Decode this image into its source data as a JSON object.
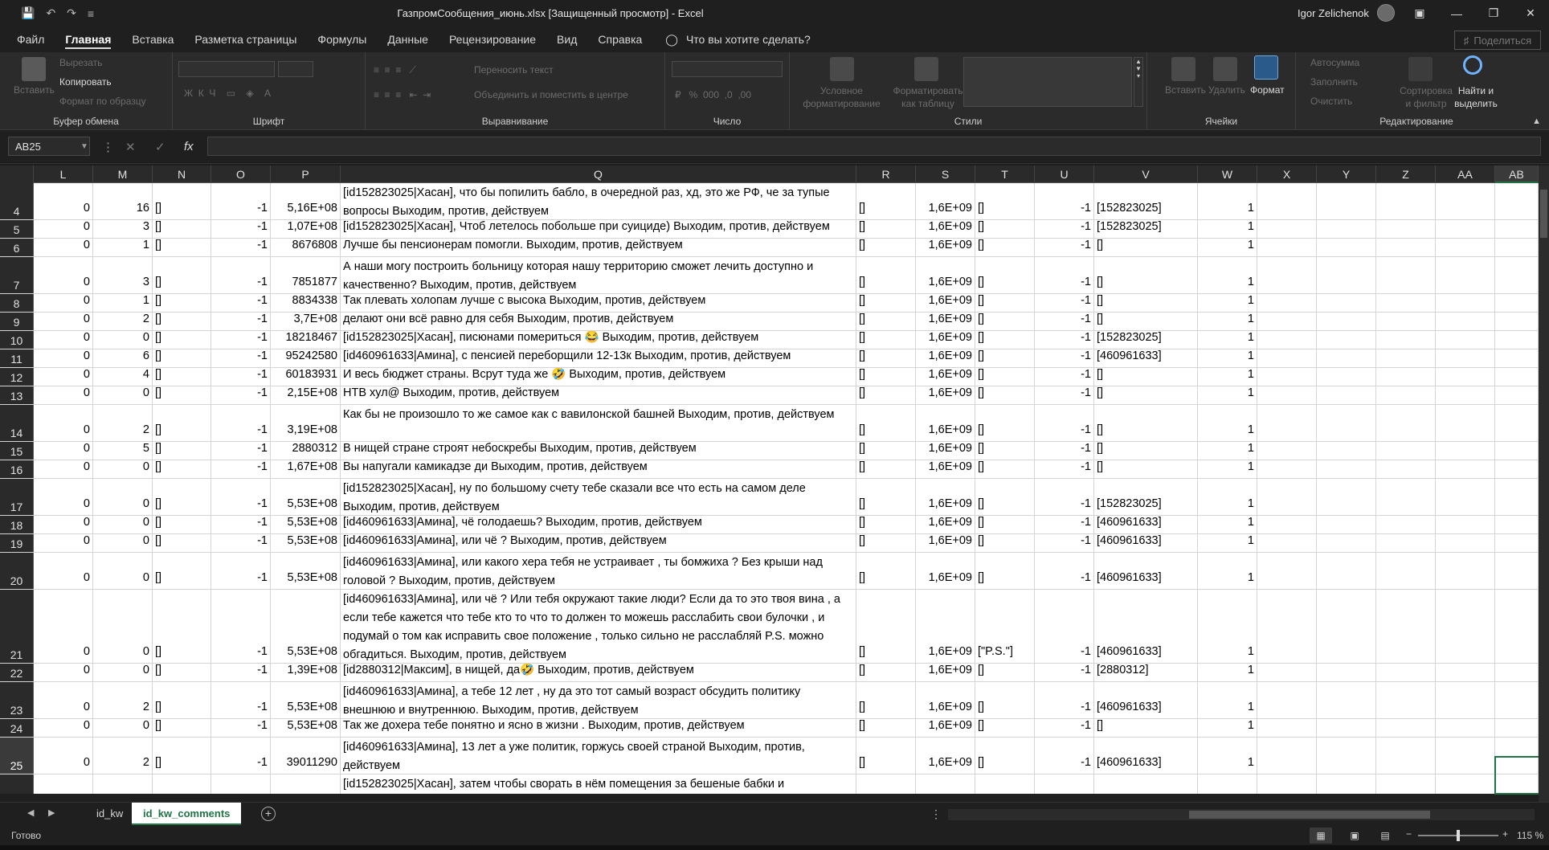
{
  "window": {
    "title": "ГазпромСообщения_июнь.xlsx  [Защищенный просмотр]  -  Excel",
    "user": "Igor Zelichenok"
  },
  "ribbon_tabs": [
    "Файл",
    "Главная",
    "Вставка",
    "Разметка страницы",
    "Формулы",
    "Данные",
    "Рецензирование",
    "Вид",
    "Справка"
  ],
  "tell_me": "Что вы хотите сделать?",
  "share_label": "Поделиться",
  "ribbon": {
    "clipboard": {
      "paste": "Вставить",
      "cut": "Вырезать",
      "copy": "Копировать",
      "format_painter": "Формат по образцу",
      "label": "Буфер обмена"
    },
    "font": {
      "label": "Шрифт"
    },
    "alignment": {
      "wrap": "Переносить текст",
      "merge": "Объединить и поместить в центре",
      "label": "Выравнивание"
    },
    "number": {
      "label": "Число"
    },
    "styles": {
      "conditional": "Условное форматирование",
      "as_table": "Форматировать как таблицу",
      "label": "Стили"
    },
    "cells": {
      "insert": "Вставить",
      "delete": "Удалить",
      "format": "Формат",
      "label": "Ячейки"
    },
    "editing": {
      "autosum": "Автосумма",
      "fill": "Заполнить",
      "clear": "Очистить",
      "sort": "Сортировка и фильтр",
      "find": "Найти и выделить",
      "label": "Редактирование"
    }
  },
  "name_box": "AB25",
  "fx_label": "fx",
  "columns": [
    "L",
    "M",
    "N",
    "O",
    "P",
    "Q",
    "R",
    "S",
    "T",
    "U",
    "V",
    "W",
    "X",
    "Y",
    "Z",
    "AA",
    "AB"
  ],
  "rows": [
    {
      "n": "4",
      "L": "0",
      "M": "16",
      "N": "[]",
      "O": "-1",
      "P": "5,16E+08",
      "Q": "[id152823025|Хасан], что бы попилить бабло, в очередной раз, хд, это же РФ, че за тупые вопросы Выходим, против, действуем",
      "R": "[]",
      "S": "1,6E+09",
      "T": "[]",
      "U": "-1",
      "V": "[152823025]",
      "W": "1"
    },
    {
      "n": "5",
      "L": "0",
      "M": "3",
      "N": "[]",
      "O": "-1",
      "P": "1,07E+08",
      "Q": "[id152823025|Хасан], Чтоб летелось побольше при суициде) Выходим, против, действуем",
      "R": "[]",
      "S": "1,6E+09",
      "T": "[]",
      "U": "-1",
      "V": "[152823025]",
      "W": "1"
    },
    {
      "n": "6",
      "L": "0",
      "M": "1",
      "N": "[]",
      "O": "-1",
      "P": "8676808",
      "Q": "Лучше бы пенсионерам помогли. Выходим, против, действуем",
      "R": "[]",
      "S": "1,6E+09",
      "T": "[]",
      "U": "-1",
      "V": "[]",
      "W": "1"
    },
    {
      "n": "7",
      "L": "0",
      "M": "3",
      "N": "[]",
      "O": "-1",
      "P": "7851877",
      "Q": "А наши могу построить больницу которая нашу территорию сможет лечить доступно и качественно? Выходим, против, действуем",
      "R": "[]",
      "S": "1,6E+09",
      "T": "[]",
      "U": "-1",
      "V": "[]",
      "W": "1"
    },
    {
      "n": "8",
      "L": "0",
      "M": "1",
      "N": "[]",
      "O": "-1",
      "P": "8834338",
      "Q": "Так плевать холопам лучше с высока Выходим, против, действуем",
      "R": "[]",
      "S": "1,6E+09",
      "T": "[]",
      "U": "-1",
      "V": "[]",
      "W": "1"
    },
    {
      "n": "9",
      "L": "0",
      "M": "2",
      "N": "[]",
      "O": "-1",
      "P": "3,7E+08",
      "Q": "делают они всё равно для себя Выходим, против, действуем",
      "R": "[]",
      "S": "1,6E+09",
      "T": "[]",
      "U": "-1",
      "V": "[]",
      "W": "1"
    },
    {
      "n": "10",
      "L": "0",
      "M": "0",
      "N": "[]",
      "O": "-1",
      "P": "18218467",
      "Q": "[id152823025|Хасан], писюнами помериться 😂 Выходим, против, действуем",
      "R": "[]",
      "S": "1,6E+09",
      "T": "[]",
      "U": "-1",
      "V": "[152823025]",
      "W": "1"
    },
    {
      "n": "11",
      "L": "0",
      "M": "6",
      "N": "[]",
      "O": "-1",
      "P": "95242580",
      "Q": "[id460961633|Амина], с пенсией переборщили 12-13к Выходим, против, действуем",
      "R": "[]",
      "S": "1,6E+09",
      "T": "[]",
      "U": "-1",
      "V": "[460961633]",
      "W": "1"
    },
    {
      "n": "12",
      "L": "0",
      "M": "4",
      "N": "[]",
      "O": "-1",
      "P": "60183931",
      "Q": "И весь бюджет страны. Всрут туда же 🤣 Выходим, против, действуем",
      "R": "[]",
      "S": "1,6E+09",
      "T": "[]",
      "U": "-1",
      "V": "[]",
      "W": "1"
    },
    {
      "n": "13",
      "L": "0",
      "M": "0",
      "N": "[]",
      "O": "-1",
      "P": "2,15E+08",
      "Q": "НТВ хул@ Выходим, против, действуем",
      "R": "[]",
      "S": "1,6E+09",
      "T": "[]",
      "U": "-1",
      "V": "[]",
      "W": "1"
    },
    {
      "n": "14",
      "L": "0",
      "M": "2",
      "N": "[]",
      "O": "-1",
      "P": "3,19E+08",
      "Q": "Как бы не произошло то же самое как с вавилонской башней Выходим, против, действуем",
      "R": "[]",
      "S": "1,6E+09",
      "T": "[]",
      "U": "-1",
      "V": "[]",
      "W": "1"
    },
    {
      "n": "15",
      "L": "0",
      "M": "5",
      "N": "[]",
      "O": "-1",
      "P": "2880312",
      "Q": "В нищей стране строят небоскребы Выходим, против, действуем",
      "R": "[]",
      "S": "1,6E+09",
      "T": "[]",
      "U": "-1",
      "V": "[]",
      "W": "1"
    },
    {
      "n": "16",
      "L": "0",
      "M": "0",
      "N": "[]",
      "O": "-1",
      "P": "1,67E+08",
      "Q": "Вы напугали камикадзе ди Выходим, против, действуем",
      "R": "[]",
      "S": "1,6E+09",
      "T": "[]",
      "U": "-1",
      "V": "[]",
      "W": "1"
    },
    {
      "n": "17",
      "L": "0",
      "M": "0",
      "N": "[]",
      "O": "-1",
      "P": "5,53E+08",
      "Q": "[id152823025|Хасан], ну по большому счету тебе сказали все что есть на самом деле Выходим, против, действуем",
      "R": "[]",
      "S": "1,6E+09",
      "T": "[]",
      "U": "-1",
      "V": "[152823025]",
      "W": "1"
    },
    {
      "n": "18",
      "L": "0",
      "M": "0",
      "N": "[]",
      "O": "-1",
      "P": "5,53E+08",
      "Q": "[id460961633|Амина], чё голодаешь? Выходим, против, действуем",
      "R": "[]",
      "S": "1,6E+09",
      "T": "[]",
      "U": "-1",
      "V": "[460961633]",
      "W": "1"
    },
    {
      "n": "19",
      "L": "0",
      "M": "0",
      "N": "[]",
      "O": "-1",
      "P": "5,53E+08",
      "Q": "[id460961633|Амина], или чё ? Выходим, против, действуем",
      "R": "[]",
      "S": "1,6E+09",
      "T": "[]",
      "U": "-1",
      "V": "[460961633]",
      "W": "1"
    },
    {
      "n": "20",
      "L": "0",
      "M": "0",
      "N": "[]",
      "O": "-1",
      "P": "5,53E+08",
      "Q": "[id460961633|Амина], или какого хера тебя не устраивает , ты бомжиха ? Без крыши над головой ? Выходим, против, действуем",
      "R": "[]",
      "S": "1,6E+09",
      "T": "[]",
      "U": "-1",
      "V": "[460961633]",
      "W": "1"
    },
    {
      "n": "21",
      "L": "0",
      "M": "0",
      "N": "[]",
      "O": "-1",
      "P": "5,53E+08",
      "Q": "[id460961633|Амина], или чё ? Или тебя окружают такие люди? Если да то это твоя вина , а если тебе кажется что тебе кто то что то должен то можешь расслабить свои булочки , и подумай о том как исправить свое положение , только сильно не расслабляй P.S. можно обгадиться. Выходим, против, действуем",
      "R": "[]",
      "S": "1,6E+09",
      "T": "[\"P.S.\"]",
      "U": "-1",
      "V": "[460961633]",
      "W": "1"
    },
    {
      "n": "22",
      "L": "0",
      "M": "0",
      "N": "[]",
      "O": "-1",
      "P": "1,39E+08",
      "Q": "[id2880312|Максим], в нищей, да🤣 Выходим, против, действуем",
      "R": "[]",
      "S": "1,6E+09",
      "T": "[]",
      "U": "-1",
      "V": "[2880312]",
      "W": "1"
    },
    {
      "n": "23",
      "L": "0",
      "M": "2",
      "N": "[]",
      "O": "-1",
      "P": "5,53E+08",
      "Q": "[id460961633|Амина], а тебе 12 лет , ну да это тот  самый возраст обсудить политику внешнюю и внутреннюю. Выходим, против, действуем",
      "R": "[]",
      "S": "1,6E+09",
      "T": "[]",
      "U": "-1",
      "V": "[460961633]",
      "W": "1"
    },
    {
      "n": "24",
      "L": "0",
      "M": "0",
      "N": "[]",
      "O": "-1",
      "P": "5,53E+08",
      "Q": "Так же дохера тебе понятно и ясно в жизни . Выходим, против, действуем",
      "R": "[]",
      "S": "1,6E+09",
      "T": "[]",
      "U": "-1",
      "V": "[]",
      "W": "1"
    },
    {
      "n": "25",
      "L": "0",
      "M": "2",
      "N": "[]",
      "O": "-1",
      "P": "39011290",
      "Q": "[id460961633|Амина], 13 лет а уже политик, горжусь своей страной Выходим, против, действуем",
      "R": "[]",
      "S": "1,6E+09",
      "T": "[]",
      "U": "-1",
      "V": "[460961633]",
      "W": "1"
    },
    {
      "n": "",
      "L": "",
      "M": "",
      "N": "",
      "O": "",
      "P": "",
      "Q": "[id152823025|Хасан], затем чтобы сворать в нём помещения за бешеные бабки и",
      "R": "",
      "S": "",
      "T": "",
      "U": "",
      "V": "",
      "W": ""
    }
  ],
  "sheets": [
    "id_kw",
    "id_kw_comments"
  ],
  "status": {
    "ready": "Готово",
    "zoom": "115 %"
  }
}
